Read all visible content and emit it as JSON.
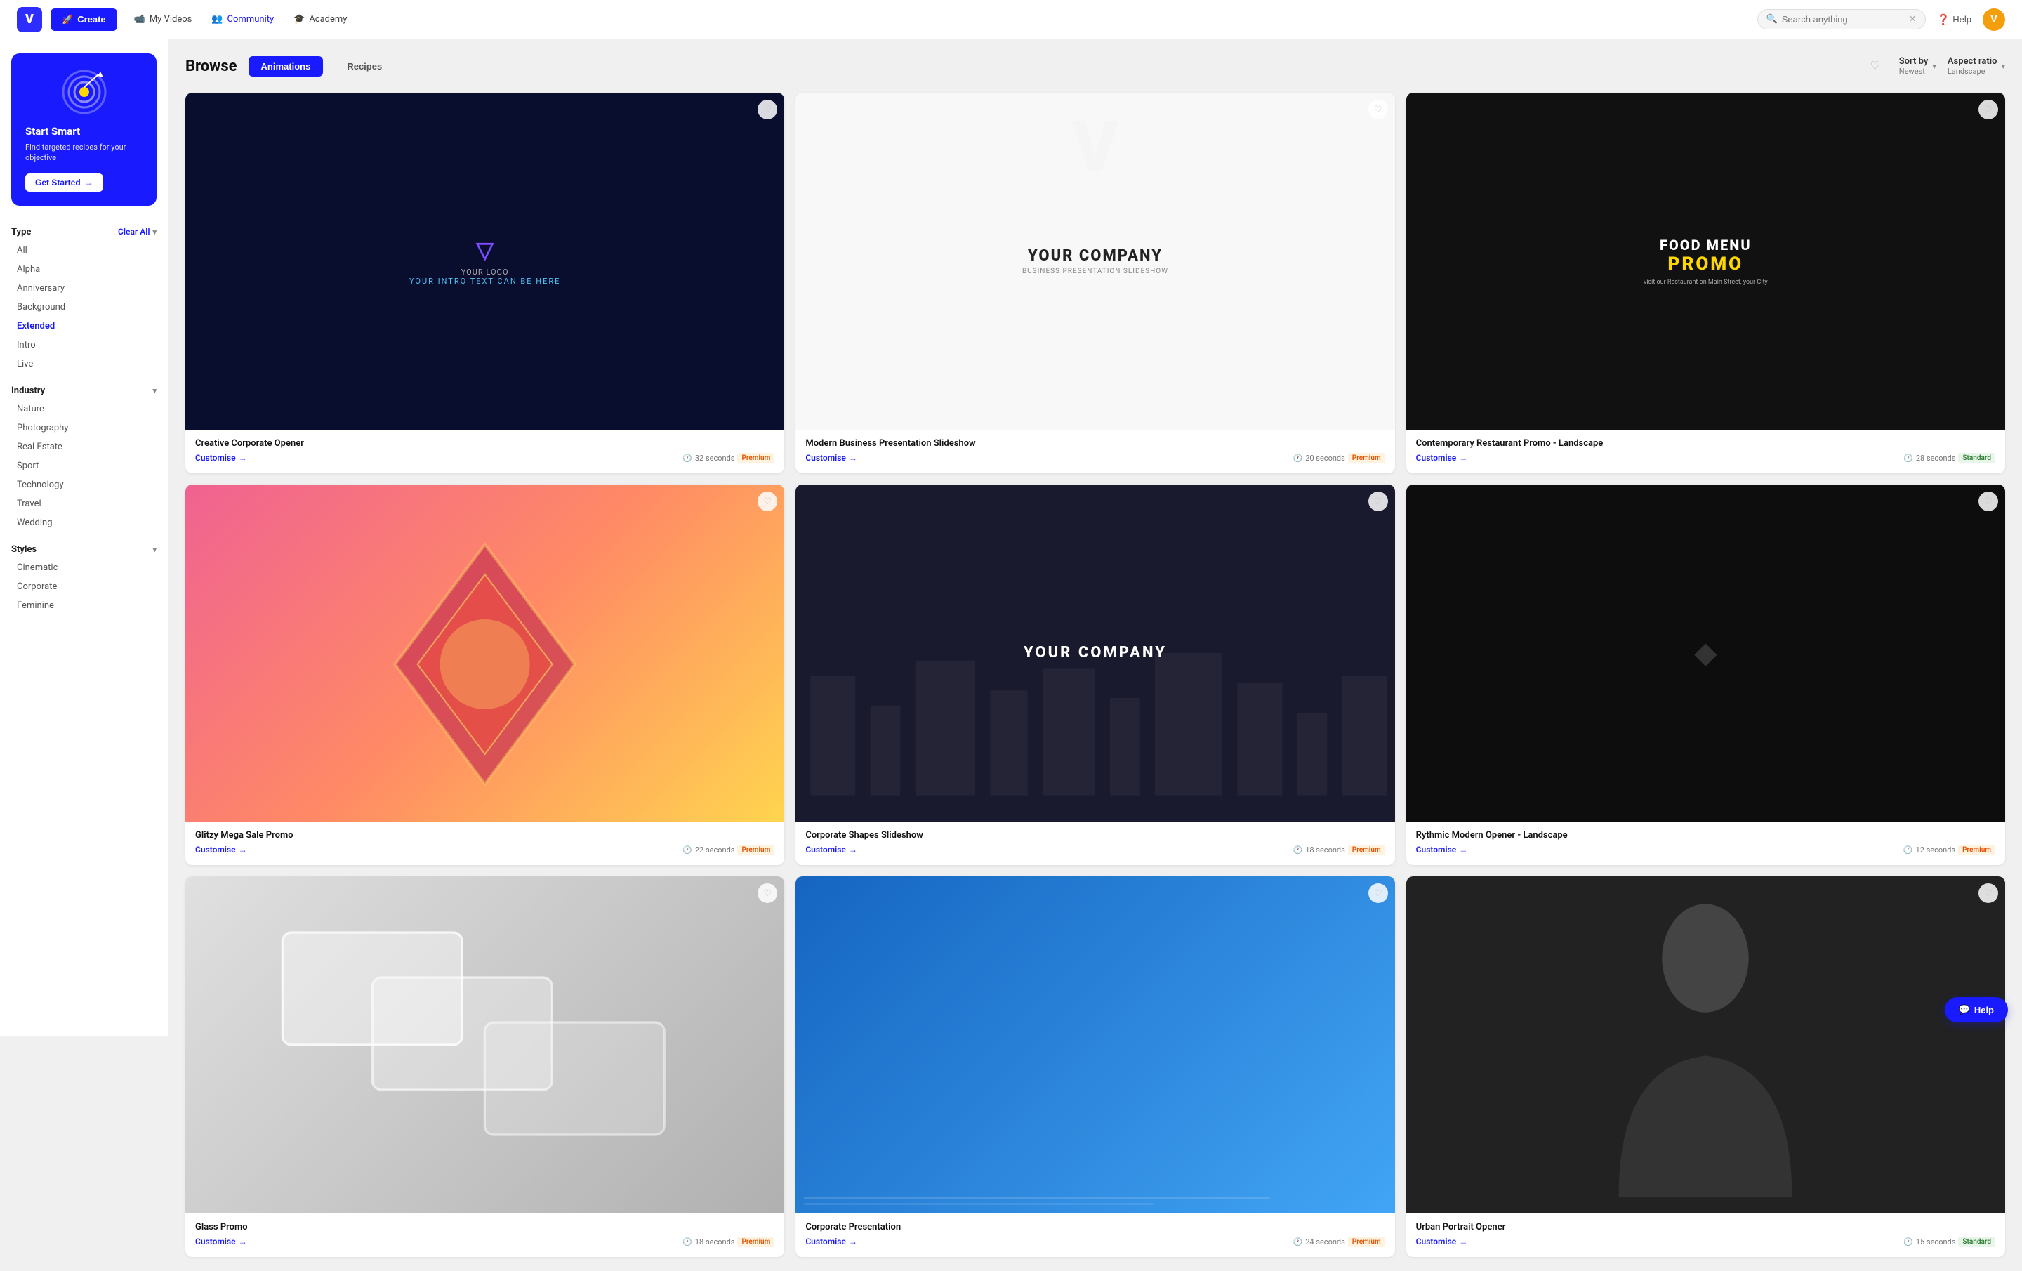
{
  "nav": {
    "logo_letter": "V",
    "create_label": "Create",
    "links": [
      {
        "id": "my-videos",
        "label": "My Videos",
        "icon": "📹"
      },
      {
        "id": "community",
        "label": "Community",
        "icon": "👥"
      },
      {
        "id": "academy",
        "label": "Academy",
        "icon": "🎓"
      }
    ],
    "search_placeholder": "Search anything",
    "help_label": "Help",
    "user_initial": "V"
  },
  "sidebar": {
    "promo": {
      "title": "Start Smart",
      "desc": "Find targeted recipes for your objective",
      "btn_label": "Get Started"
    },
    "type_section": {
      "label": "Type",
      "clear_label": "Clear All",
      "items": [
        {
          "id": "all",
          "label": "All",
          "active": false
        },
        {
          "id": "alpha",
          "label": "Alpha",
          "active": false
        },
        {
          "id": "anniversary",
          "label": "Anniversary",
          "active": false
        },
        {
          "id": "background",
          "label": "Background",
          "active": false
        },
        {
          "id": "extended",
          "label": "Extended",
          "active": true
        },
        {
          "id": "intro",
          "label": "Intro",
          "active": false
        },
        {
          "id": "live",
          "label": "Live",
          "active": false
        }
      ]
    },
    "industry_section": {
      "label": "Industry",
      "items": [
        {
          "id": "nature",
          "label": "Nature",
          "active": false
        },
        {
          "id": "photography",
          "label": "Photography",
          "active": false
        },
        {
          "id": "real-estate",
          "label": "Real Estate",
          "active": false
        },
        {
          "id": "sport",
          "label": "Sport",
          "active": false
        },
        {
          "id": "technology",
          "label": "Technology",
          "active": false
        },
        {
          "id": "travel",
          "label": "Travel",
          "active": false
        },
        {
          "id": "wedding",
          "label": "Wedding",
          "active": false
        }
      ]
    },
    "styles_section": {
      "label": "Styles",
      "items": [
        {
          "id": "cinematic",
          "label": "Cinematic",
          "active": false
        },
        {
          "id": "corporate",
          "label": "Corporate",
          "active": false
        },
        {
          "id": "feminine",
          "label": "Feminine",
          "active": false
        }
      ]
    }
  },
  "browse": {
    "title": "Browse",
    "tabs": [
      {
        "id": "animations",
        "label": "Animations",
        "active": true
      },
      {
        "id": "recipes",
        "label": "Recipes",
        "active": false
      }
    ],
    "sort": {
      "label": "Sort by",
      "value": "Newest"
    },
    "aspect": {
      "label": "Aspect ratio",
      "value": "Landscape"
    }
  },
  "cards": [
    {
      "id": "card-1",
      "title": "Creative Corporate Opener",
      "customise": "Customise",
      "duration": "32 seconds",
      "badge": "Premium",
      "badge_type": "premium",
      "thumb_type": "dark-blue",
      "thumb_content": "logo"
    },
    {
      "id": "card-2",
      "title": "Modern Business Presentation Slideshow",
      "customise": "Customise",
      "duration": "20 seconds",
      "badge": "Premium",
      "badge_type": "premium",
      "thumb_type": "white",
      "thumb_content": "company"
    },
    {
      "id": "card-3",
      "title": "Contemporary Restaurant Promo - Landscape",
      "customise": "Customise",
      "duration": "28 seconds",
      "badge": "Standard",
      "badge_type": "standard",
      "thumb_type": "dark",
      "thumb_content": "food-promo"
    },
    {
      "id": "card-4",
      "title": "Glitzy Mega Sale Promo",
      "customise": "Customise",
      "duration": "22 seconds",
      "badge": "Premium",
      "badge_type": "premium",
      "thumb_type": "pink",
      "thumb_content": "geometric"
    },
    {
      "id": "card-5",
      "title": "Corporate Shapes Slideshow",
      "customise": "Customise",
      "duration": "18 seconds",
      "badge": "Premium",
      "badge_type": "premium",
      "thumb_type": "dark-city",
      "thumb_content": "city-company"
    },
    {
      "id": "card-6",
      "title": "Rythmic Modern Opener - Landscape",
      "customise": "Customise",
      "duration": "12 seconds",
      "badge": "Premium",
      "badge_type": "premium",
      "thumb_type": "dark2",
      "thumb_content": "dark-minimal"
    },
    {
      "id": "card-7",
      "title": "Glass Promo",
      "customise": "Customise",
      "duration": "18 seconds",
      "badge": "Premium",
      "badge_type": "premium",
      "thumb_type": "glass",
      "thumb_content": "glass-shapes"
    },
    {
      "id": "card-8",
      "title": "Corporate Presentation",
      "customise": "Customise",
      "duration": "24 seconds",
      "badge": "Premium",
      "badge_type": "premium",
      "thumb_type": "blue-corp",
      "thumb_content": "blue-corp"
    },
    {
      "id": "card-9",
      "title": "Urban Portrait Opener",
      "customise": "Customise",
      "duration": "15 seconds",
      "badge": "Standard",
      "badge_type": "standard",
      "thumb_type": "dark-portrait",
      "thumb_content": "portrait"
    }
  ],
  "help_fab": "Help"
}
